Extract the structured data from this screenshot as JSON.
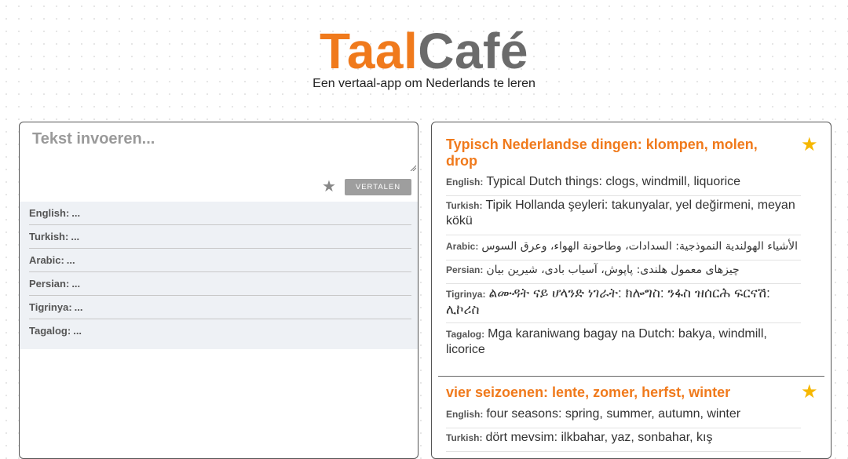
{
  "header": {
    "logo_part1": "Taal",
    "logo_part2": "Café",
    "tagline": "Een vertaal-app om Nederlands te leren"
  },
  "input": {
    "placeholder": "Tekst invoeren...",
    "value": "",
    "translate_label": "VERTALEN",
    "star_icon": "star-icon"
  },
  "languages": [
    {
      "label": "English:",
      "value": "..."
    },
    {
      "label": "Turkish:",
      "value": "..."
    },
    {
      "label": "Arabic:",
      "value": "..."
    },
    {
      "label": "Persian:",
      "value": "..."
    },
    {
      "label": "Tigrinya:",
      "value": "..."
    },
    {
      "label": "Tagalog:",
      "value": "..."
    }
  ],
  "saved": [
    {
      "title": "Typisch Nederlandse dingen: klompen, molen, drop",
      "translations": [
        {
          "label": "English:",
          "text": "Typical Dutch things: clogs, windmill, liquorice"
        },
        {
          "label": "Turkish:",
          "text": "Tipik Hollanda şeyleri: takunyalar, yel değirmeni, meyan kökü"
        },
        {
          "label": "Arabic:",
          "text": "الأشياء الهولندية النموذجية: السدادات، وطاحونة الهواء، وعرق السوس"
        },
        {
          "label": "Persian:",
          "text": "چیزهای معمول هلندی: پاپوش، آسیاب بادی، شیرین بیان"
        },
        {
          "label": "Tigrinya:",
          "text": "ልሙዳት ናይ ሆላንድ ነገራት: ክሎግስ: ንፋስ ዝሰርሕ ፍርናሽ: ሊኮሪስ"
        },
        {
          "label": "Tagalog:",
          "text": "Mga karaniwang bagay na Dutch: bakya, windmill, licorice"
        }
      ]
    },
    {
      "title": "vier seizoenen: lente, zomer, herfst, winter",
      "translations": [
        {
          "label": "English:",
          "text": "four seasons: spring, summer, autumn, winter"
        },
        {
          "label": "Turkish:",
          "text": "dört mevsim: ilkbahar, yaz, sonbahar, kış"
        }
      ]
    }
  ],
  "colors": {
    "brand_orange": "#f07a1c",
    "brand_gray": "#6b6b6b",
    "star_gold": "#f6b700",
    "button_gray": "#9e9e9e"
  }
}
